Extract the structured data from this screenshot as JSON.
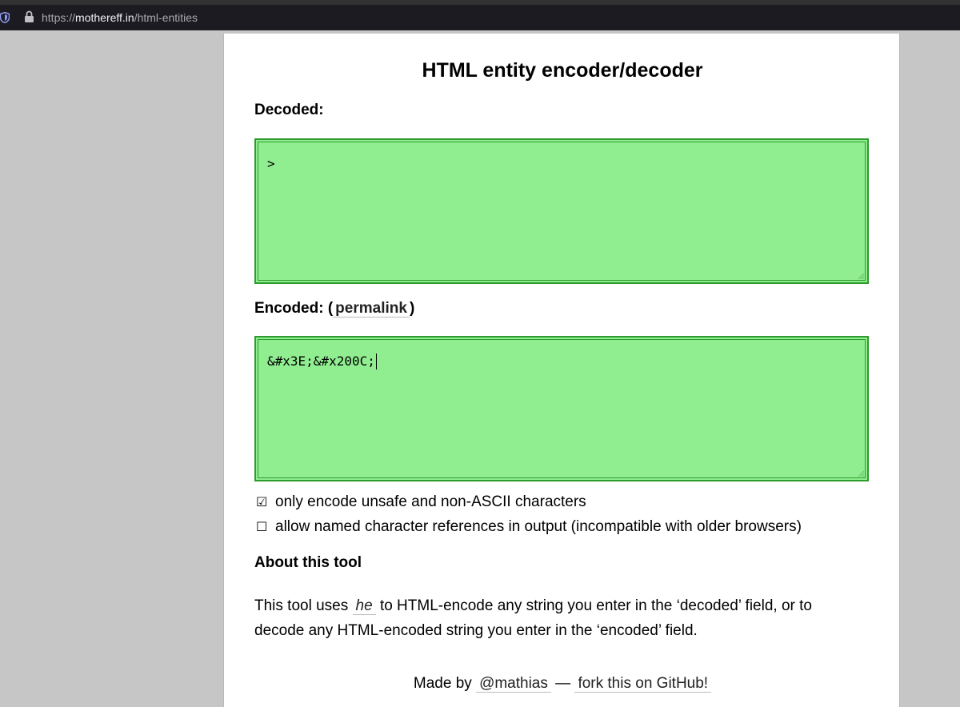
{
  "browser": {
    "url_prefix": "https://",
    "url_host": "mothereff.in",
    "url_path": "/html-entities"
  },
  "page": {
    "title": "HTML entity encoder/decoder",
    "decoded_label": "Decoded:",
    "decoded_value": ">",
    "encoded_label": "Encoded: (",
    "encoded_label_close": ")",
    "permalink_text": "permalink",
    "encoded_value": "&#x3E;&#x200C;",
    "options": [
      {
        "label": "only encode unsafe and non-ASCII characters",
        "checked": true
      },
      {
        "label": "allow named character references in output (incompatible with older browsers)",
        "checked": false
      }
    ],
    "about_heading": "About this tool",
    "about_text_1": "This tool uses",
    "about_link": "he",
    "about_text_2": "to HTML-encode any string you enter in the ‘decoded’ field, or to decode any HTML-encoded string you enter in the ‘encoded’ field.",
    "footer_made_by": "Made by",
    "footer_author": "@mathias",
    "footer_dash": "—",
    "footer_fork": "fork this on GitHub!"
  },
  "colors": {
    "box_fill": "#90ee90",
    "box_border": "#2e9b2e",
    "page_bg": "#ffffff",
    "outer_bg": "#c6c6c6",
    "chrome_bg": "#1c1b22"
  },
  "icons": [
    "shield-icon",
    "lock-icon",
    "resize-grip-icon",
    "checkbox-checked-icon",
    "checkbox-unchecked-icon"
  ]
}
